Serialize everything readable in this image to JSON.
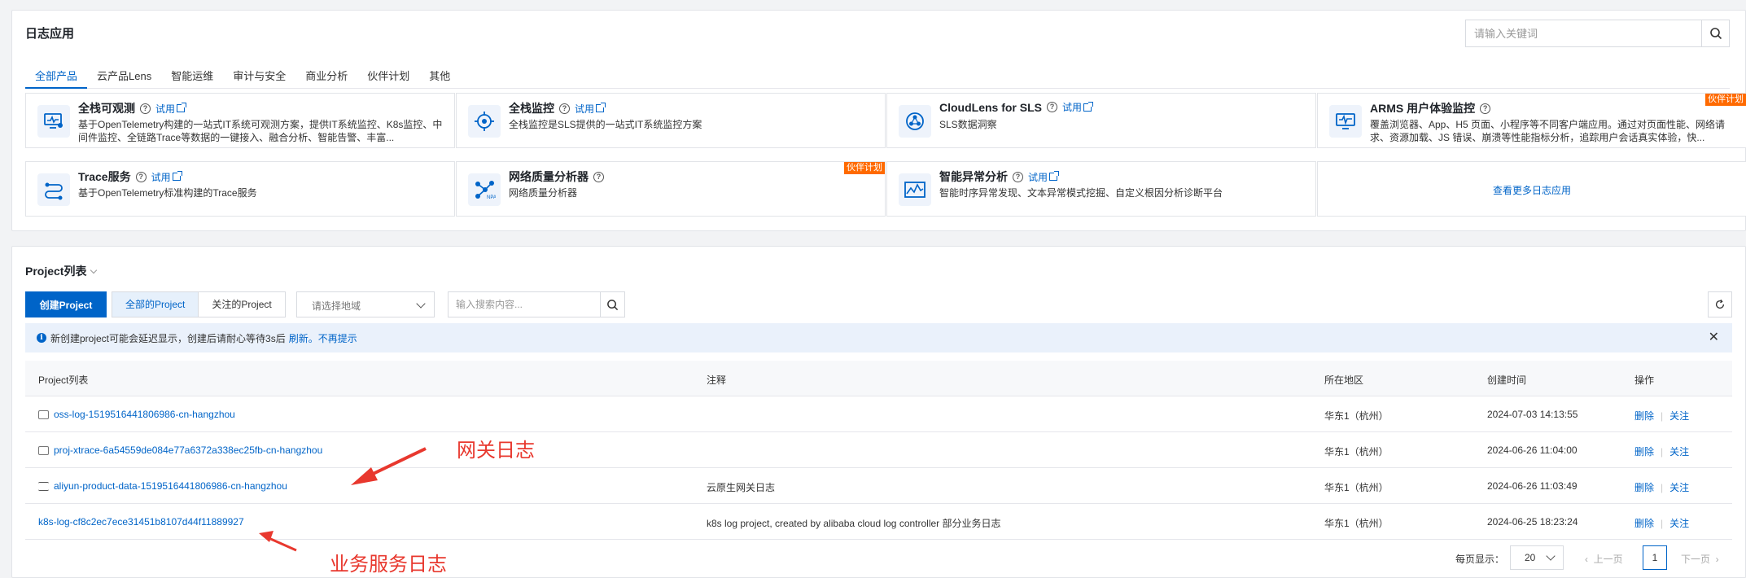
{
  "apps": {
    "title": "日志应用",
    "search_placeholder": "请输入关键词",
    "tabs": [
      "全部产品",
      "云产品Lens",
      "智能运维",
      "审计与安全",
      "商业分析",
      "伙伴计划",
      "其他"
    ],
    "cards": [
      {
        "title": "全栈可观测",
        "trial": "试用",
        "desc": "基于OpenTelemetry构建的一站式IT系统可观测方案，提供IT系统监控、K8s监控、中间件监控、全链路Trace等数据的一键接入、融合分析、智能告警、丰富...",
        "icon": "monitor-icon"
      },
      {
        "title": "全栈监控",
        "trial": "试用",
        "desc": "全栈监控是SLS提供的一站式IT系统监控方案",
        "icon": "target-icon"
      },
      {
        "title": "CloudLens for SLS",
        "trial": "试用",
        "desc": "SLS数据洞察",
        "icon": "cluster-icon"
      },
      {
        "title": "ARMS 用户体验监控",
        "desc": "覆盖浏览器、App、H5 页面、小程序等不同客户端应用。通过对页面性能、网络请求、资源加载、JS 错误、崩溃等性能指标分析，追踪用户会话真实体验，快...",
        "badge": "伙伴计划",
        "icon": "screen-icon"
      },
      {
        "title": "Trace服务",
        "trial": "试用",
        "desc": "基于OpenTelemetry标准构建的Trace服务",
        "icon": "trace-icon"
      },
      {
        "title": "网络质量分析器",
        "desc": "网络质量分析器",
        "badge": "伙伴计划",
        "icon": "network-icon"
      },
      {
        "title": "智能异常分析",
        "trial": "试用",
        "desc": "智能时序异常发现、文本异常模式挖掘、自定义根因分析诊断平台",
        "icon": "anomaly-icon"
      }
    ],
    "more_link": "查看更多日志应用"
  },
  "projects": {
    "title": "Project列表",
    "create_button": "创建Project",
    "filter_all": "全部的Project",
    "filter_followed": "关注的Project",
    "region_placeholder": "请选择地域",
    "search_placeholder": "输入搜索内容...",
    "notice": {
      "text": "新创建project可能会延迟显示，创建后请耐心等待3s后",
      "refresh": "刷新",
      "dismiss": "不再提示"
    },
    "columns": [
      "Project列表",
      "注释",
      "所在地区",
      "创建时间",
      "操作"
    ],
    "rows": [
      {
        "name": "oss-log-1519516441806986-cn-hangzhou",
        "note": "",
        "region": "华东1（杭州）",
        "created": "2024-07-03 14:13:55",
        "delete": "删除",
        "follow": "关注"
      },
      {
        "name": "proj-xtrace-6a54559de084e77a6372a338ec25fb-cn-hangzhou",
        "note": "",
        "region": "华东1（杭州）",
        "created": "2024-06-26 11:04:00",
        "delete": "删除",
        "follow": "关注"
      },
      {
        "name": "aliyun-product-data-1519516441806986-cn-hangzhou",
        "note": "云原生网关日志",
        "region": "华东1（杭州）",
        "created": "2024-06-26 11:03:49",
        "delete": "删除",
        "follow": "关注"
      },
      {
        "name": "k8s-log-cf8c2ec7ece31451b8107d44f11889927",
        "note": "k8s log project, created by alibaba cloud log controller 部分业务日志",
        "region": "华东1（杭州）",
        "created": "2024-06-25 18:23:24",
        "delete": "删除",
        "follow": "关注"
      }
    ],
    "pagination": {
      "page_size_label": "每页显示：",
      "page_size": "20",
      "prev": "上一页",
      "current_page": "1",
      "next": "下一页"
    }
  },
  "annotations": {
    "gateway_log": "网关日志",
    "business_log": "业务服务日志",
    "color": "#e8382e"
  }
}
